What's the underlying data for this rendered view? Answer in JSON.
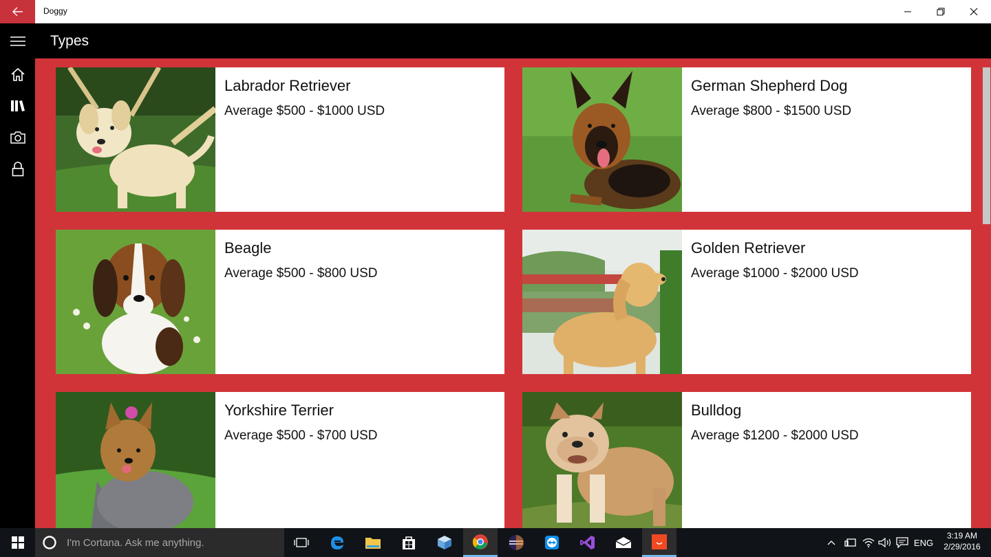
{
  "window": {
    "app_title": "Doggy"
  },
  "header": {
    "page_title": "Types"
  },
  "sidebar": {
    "items": [
      {
        "icon": "home-icon",
        "label": ""
      },
      {
        "icon": "library-icon",
        "label": ""
      },
      {
        "icon": "camera-icon",
        "label": ""
      },
      {
        "icon": "lock-icon",
        "label": ""
      }
    ]
  },
  "dogs": [
    {
      "name": "Labrador Retriever",
      "price": "Average $500 - $1000 USD"
    },
    {
      "name": "German Shepherd Dog",
      "price": "Average $800 - $1500 USD"
    },
    {
      "name": "Beagle",
      "price": "Average $500 - $800 USD"
    },
    {
      "name": "Golden Retriever",
      "price": "Average $1000 - $2000 USD"
    },
    {
      "name": "Yorkshire Terrier",
      "price": "Average $500 - $700 USD"
    },
    {
      "name": "Bulldog",
      "price": "Average $1200 - $2000 USD"
    }
  ],
  "taskbar": {
    "cortana_placeholder": "I'm Cortana. Ask me anything.",
    "language": "ENG",
    "time": "3:19 AM",
    "date": "2/29/2016"
  },
  "colors": {
    "accent": "#d13438",
    "titlebar_back": "#c8323a",
    "chrome": "#000000",
    "taskbar": "#101418"
  }
}
